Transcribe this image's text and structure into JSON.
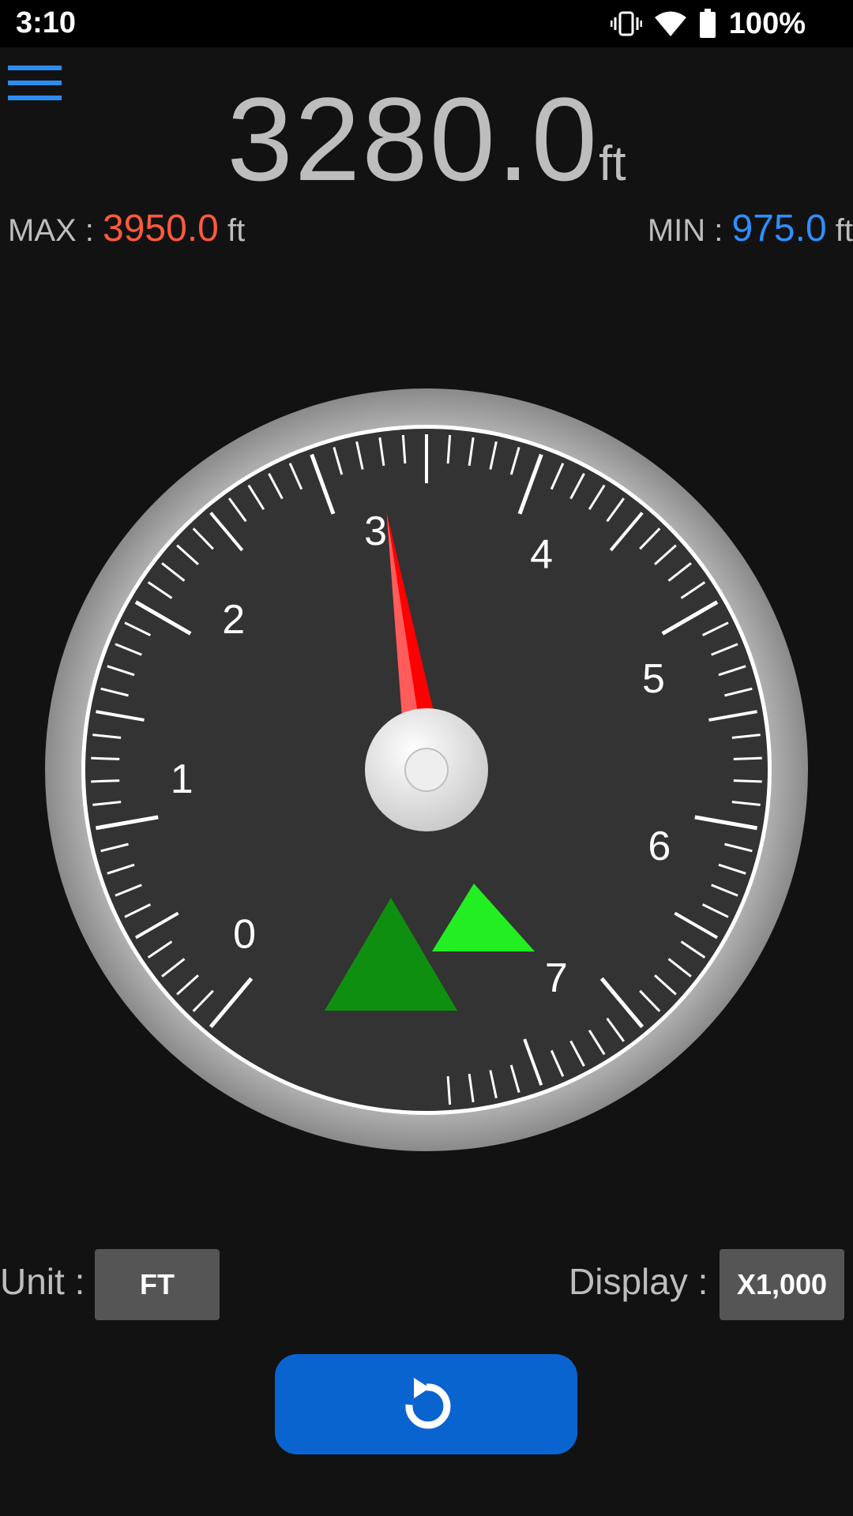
{
  "status": {
    "time": "3:10",
    "battery": "100%",
    "icons": [
      "vibrate-icon",
      "wifi-icon",
      "battery-icon"
    ]
  },
  "menu": {
    "icon": "hamburger-menu-icon"
  },
  "reading": {
    "value": "3280.0",
    "unit": "ft"
  },
  "max": {
    "label": "MAX : ",
    "value": "3950.0",
    "unit": "ft"
  },
  "min": {
    "label": "MIN : ",
    "value": "975.0",
    "unit": "ft"
  },
  "gauge": {
    "tick_labels": [
      "0",
      "1",
      "2",
      "3",
      "4",
      "5",
      "6",
      "7"
    ],
    "needle_value": 3.28,
    "scale_max": 8,
    "logo_icon": "mountain-icon"
  },
  "controls": {
    "unit_label": "Unit :",
    "unit_value": "FT",
    "display_label": "Display :",
    "display_value": "X1,000",
    "reset_icon": "refresh-icon"
  },
  "colors": {
    "max": "#ff5a3c",
    "min": "#2e8fff",
    "accent": "#0a64d0",
    "needle": "#ff0000"
  }
}
